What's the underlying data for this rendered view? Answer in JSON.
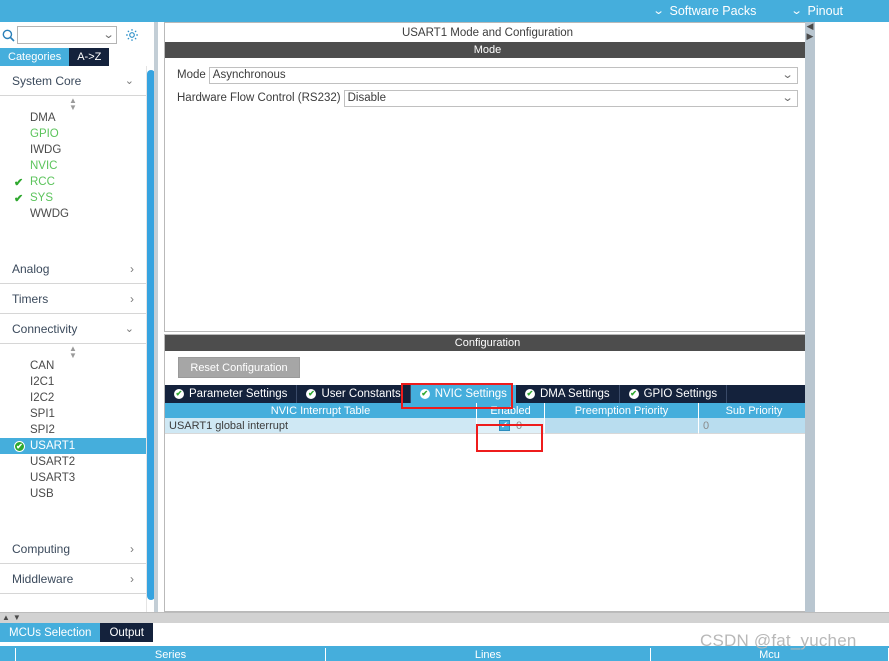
{
  "topbar": {
    "items": [
      {
        "label": "Software Packs",
        "icon": "chevron-down-icon"
      },
      {
        "label": "Pinout",
        "icon": "chevron-down-icon"
      }
    ],
    "background": "#45aedc"
  },
  "sidebar": {
    "search": {
      "value": "",
      "placeholder": "",
      "icon": "search-icon"
    },
    "settings_icon": "gear-icon",
    "view_tabs": [
      {
        "label": "Categories",
        "selected": true
      },
      {
        "label": "A->Z",
        "selected": false
      }
    ],
    "groups": [
      {
        "label": "System Core",
        "expanded": true,
        "items": [
          {
            "label": "DMA",
            "state": "none"
          },
          {
            "label": "GPIO",
            "state": "partial"
          },
          {
            "label": "IWDG",
            "state": "none"
          },
          {
            "label": "NVIC",
            "state": "partial"
          },
          {
            "label": "RCC",
            "state": "check"
          },
          {
            "label": "SYS",
            "state": "check"
          },
          {
            "label": "WWDG",
            "state": "none"
          }
        ]
      },
      {
        "label": "Analog",
        "expanded": false,
        "items": []
      },
      {
        "label": "Timers",
        "expanded": false,
        "items": []
      },
      {
        "label": "Connectivity",
        "expanded": true,
        "items": [
          {
            "label": "CAN",
            "state": "none"
          },
          {
            "label": "I2C1",
            "state": "none"
          },
          {
            "label": "I2C2",
            "state": "none"
          },
          {
            "label": "SPI1",
            "state": "none"
          },
          {
            "label": "SPI2",
            "state": "none"
          },
          {
            "label": "USART1",
            "state": "selected"
          },
          {
            "label": "USART2",
            "state": "none"
          },
          {
            "label": "USART3",
            "state": "none"
          },
          {
            "label": "USB",
            "state": "none"
          }
        ]
      },
      {
        "label": "Computing",
        "expanded": false,
        "items": []
      },
      {
        "label": "Middleware",
        "expanded": false,
        "items": []
      }
    ]
  },
  "mode_panel": {
    "title": "USART1 Mode and Configuration",
    "section_label": "Mode",
    "fields": [
      {
        "label": "Mode",
        "value": "Asynchronous"
      },
      {
        "label": "Hardware Flow Control (RS232)",
        "value": "Disable"
      }
    ]
  },
  "config_panel": {
    "section_label": "Configuration",
    "reset_button": "Reset Configuration",
    "tabs": [
      {
        "label": "Parameter Settings",
        "active": false
      },
      {
        "label": "User Constants",
        "active": false
      },
      {
        "label": "NVIC Settings",
        "active": true
      },
      {
        "label": "DMA Settings",
        "active": false
      },
      {
        "label": "GPIO Settings",
        "active": false
      }
    ],
    "nvic_table": {
      "columns": [
        "NVIC Interrupt Table",
        "Enabled",
        "Preemption Priority",
        "Sub Priority"
      ],
      "rows": [
        {
          "name": "USART1 global interrupt",
          "enabled": true,
          "preemption_priority": "0",
          "sub_priority": "0"
        }
      ]
    }
  },
  "bottom": {
    "tabs": [
      {
        "label": "MCUs Selection",
        "selected": true
      },
      {
        "label": "Output",
        "selected": false
      }
    ],
    "table_columns": [
      "Series",
      "Lines",
      "Mcu"
    ]
  },
  "watermark": {
    "text": "CSDN @fat_yuchen"
  },
  "colors": {
    "accent_blue": "#45aedc",
    "tab_navy": "#14223c",
    "annotation_red": "#ee1c1c",
    "check_green": "#2fa82f",
    "section_gray": "#4d4d4d"
  }
}
